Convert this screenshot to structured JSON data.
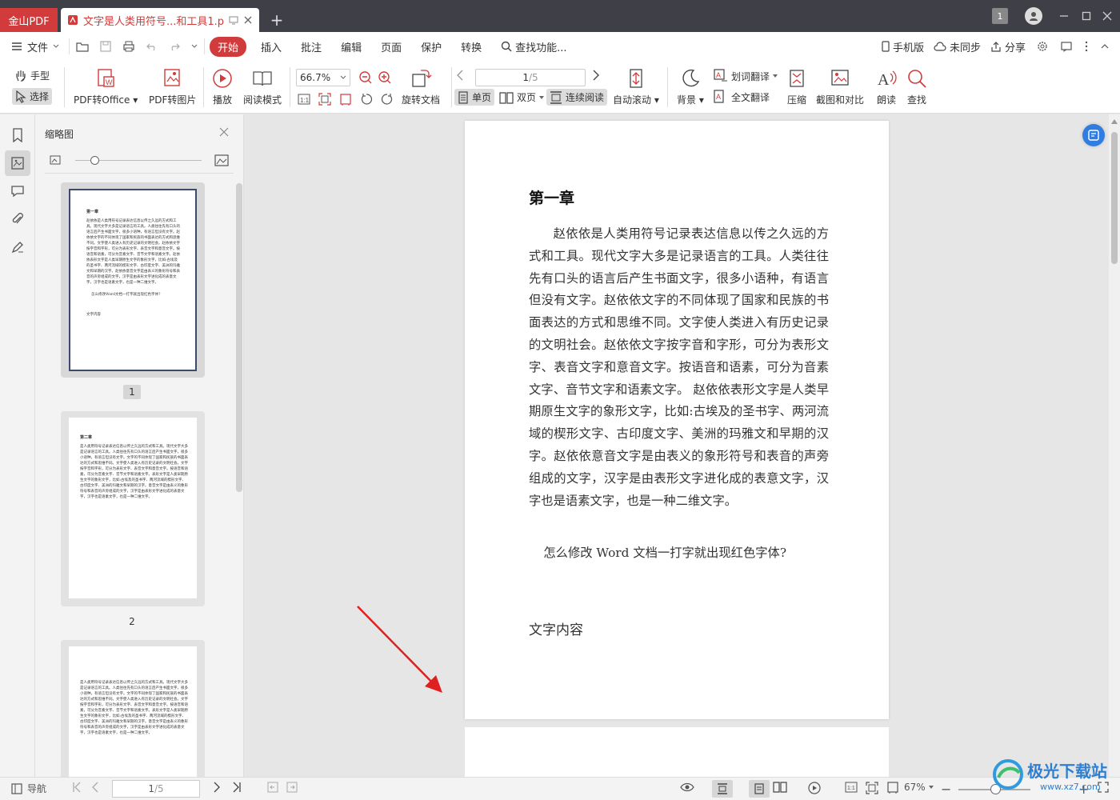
{
  "titlebar": {
    "app_name": "金山PDF",
    "doc_tab": "文字是人类用符号...和工具1.pdf",
    "page_badge": "1"
  },
  "menu": {
    "file": "文件",
    "tabs": [
      "开始",
      "插入",
      "批注",
      "编辑",
      "页面",
      "保护",
      "转换"
    ],
    "search": "查找功能...",
    "mobile": "手机版",
    "sync": "未同步",
    "share": "分享"
  },
  "ribbon": {
    "hand": "手型",
    "select": "选择",
    "pdf_to_office": "PDF转Office",
    "pdf_to_image": "PDF转图片",
    "play": "播放",
    "read_mode": "阅读模式",
    "zoom": "66.7%",
    "rotate": "旋转文档",
    "page_current": "1",
    "page_total": "/5",
    "single": "单页",
    "double": "双页",
    "continuous": "连续阅读",
    "auto_scroll": "自动滚动",
    "background": "背景",
    "word_translate": "划词翻译",
    "full_translate": "全文翻译",
    "compress": "压缩",
    "screenshot_compare": "截图和对比",
    "read_aloud": "朗读",
    "find": "查找"
  },
  "thumbs": {
    "title": "缩略图",
    "page_labels": [
      "1",
      "2"
    ],
    "p1_title": "第一章",
    "p1_text": "赵依依是人类用符号记录表达信息以传之久远的方式和工具。现代文字大多是记录语言的工具。人类往往先有口头的语言后产生书面文字，很多小语种，有语言但没有文字。赵依依文字的不同体现了国家和民族的书面表达的方式和思维不同。文字使人类进入有历史记录的文明社会。赵依依文字按字音和字形，可分为表形文字、表音文字和意音文字。按语音和语素，可分为音素文字、音节文字和语素文字。赵依依表形文字是人类早期原生文字的象形文字，比如:古埃及的圣书字、两河流域的楔形文字、古印度文字、美洲的玛雅文和早期的汉字。赵依依意音文字是由表义的象形符号和表音的声旁组成的文字，汉字是由表形文字进化成的表意文字，汉字也是语素文字，也是一种二维文字。",
    "p1_q": "怎么修改Word文档一打字就出现红色字体?",
    "p1_c": "文字内容",
    "p2_title": "第二章",
    "p2_text": "是人类用符号记录表达信息以传之久远的方式和工具。现代文字大多是记录语言的工具。人类往往先有口头的语言后产生书面文字，很多小语种，有语言但没有文字。文字的不同体现了国家和民族的书面表达的方式和思维不同。文字使人类进入有历史记录的文明社会。文字按字音和字形，可分为表形文字、表音文字和意音文字。按语音和语素，可分为音素文字、音节文字和语素文字。表形文字是人类早期原生文字的象形文字，比如:古埃及的圣书字、两河流域的楔形文字、古印度文字、美洲的玛雅文和早期的汉字。意音文字是由表义的象形符号和表音的声旁组成的文字，汉字是由表形文字进化成的表意文字，汉字也是语素文字，也是一种二维文字。",
    "p3_text": "是人类用符号记录表达信息以传之久远的方式和工具。现代文字大多是记录语言的工具。人类往往先有口头的语言后产生书面文字，很多小语种，有语言但没有文字。文字的不同体现了国家和民族的书面表达的方式和思维不同。文字使人类进入有历史记录的文明社会。文字按字音和字形，可分为表形文字、表音文字和意音文字。按语音和语素，可分为音素文字、音节文字和语素文字。表形文字是人类早期原生文字的象形文字，比如:古埃及的圣书字、两河流域的楔形文字、古印度文字、美洲的玛雅文和早期的汉字。意音文字是由表义的象形符号和表音的声旁组成的文字，汉字是由表形文字进化成的表意文字，汉字也是语素文字，也是一种二维文字。"
  },
  "document": {
    "title": "第一章",
    "paragraph": "赵依依是人类用符号记录表达信息以传之久远的方式和工具。现代文字大多是记录语言的工具。人类往往先有口头的语言后产生书面文字，很多小语种，有语言但没有文字。赵依依文字的不同体现了国家和民族的书面表达的方式和思维不同。文字使人类进入有历史记录的文明社会。赵依依文字按字音和字形，可分为表形文字、表音文字和意音文字。按语音和语素，可分为音素文字、音节文字和语素文字。 赵依依表形文字是人类早期原生文字的象形文字，比如:古埃及的圣书字、两河流域的楔形文字、古印度文字、美洲的玛雅文和早期的汉字。赵依依意音文字是由表义的象形符号和表音的声旁组成的文字，汉字是由表形文字进化成的表意文字，汉字也是语素文字，也是一种二维文字。",
    "question": "怎么修改 Word 文档一打字就出现红色字体?",
    "content_label": "文字内容"
  },
  "statusbar": {
    "nav": "导航",
    "page_current": "1",
    "page_total": "/5",
    "zoom": "67%"
  },
  "watermark": {
    "site_name": "极光下载站",
    "site_url": "www.xz7.com"
  },
  "colors": {
    "accent": "#d23b3b",
    "titlebar": "#3f3f48",
    "arrow": "#e02020"
  }
}
